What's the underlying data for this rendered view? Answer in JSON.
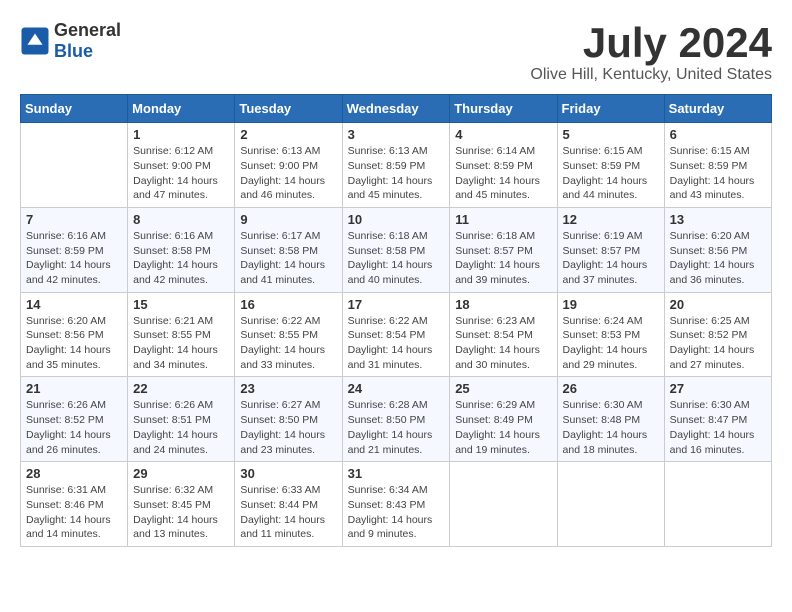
{
  "logo": {
    "text_general": "General",
    "text_blue": "Blue"
  },
  "title": "July 2024",
  "subtitle": "Olive Hill, Kentucky, United States",
  "weekdays": [
    "Sunday",
    "Monday",
    "Tuesday",
    "Wednesday",
    "Thursday",
    "Friday",
    "Saturday"
  ],
  "weeks": [
    [
      {
        "day": "",
        "info": ""
      },
      {
        "day": "1",
        "info": "Sunrise: 6:12 AM\nSunset: 9:00 PM\nDaylight: 14 hours\nand 47 minutes."
      },
      {
        "day": "2",
        "info": "Sunrise: 6:13 AM\nSunset: 9:00 PM\nDaylight: 14 hours\nand 46 minutes."
      },
      {
        "day": "3",
        "info": "Sunrise: 6:13 AM\nSunset: 8:59 PM\nDaylight: 14 hours\nand 45 minutes."
      },
      {
        "day": "4",
        "info": "Sunrise: 6:14 AM\nSunset: 8:59 PM\nDaylight: 14 hours\nand 45 minutes."
      },
      {
        "day": "5",
        "info": "Sunrise: 6:15 AM\nSunset: 8:59 PM\nDaylight: 14 hours\nand 44 minutes."
      },
      {
        "day": "6",
        "info": "Sunrise: 6:15 AM\nSunset: 8:59 PM\nDaylight: 14 hours\nand 43 minutes."
      }
    ],
    [
      {
        "day": "7",
        "info": "Sunrise: 6:16 AM\nSunset: 8:59 PM\nDaylight: 14 hours\nand 42 minutes."
      },
      {
        "day": "8",
        "info": "Sunrise: 6:16 AM\nSunset: 8:58 PM\nDaylight: 14 hours\nand 42 minutes."
      },
      {
        "day": "9",
        "info": "Sunrise: 6:17 AM\nSunset: 8:58 PM\nDaylight: 14 hours\nand 41 minutes."
      },
      {
        "day": "10",
        "info": "Sunrise: 6:18 AM\nSunset: 8:58 PM\nDaylight: 14 hours\nand 40 minutes."
      },
      {
        "day": "11",
        "info": "Sunrise: 6:18 AM\nSunset: 8:57 PM\nDaylight: 14 hours\nand 39 minutes."
      },
      {
        "day": "12",
        "info": "Sunrise: 6:19 AM\nSunset: 8:57 PM\nDaylight: 14 hours\nand 37 minutes."
      },
      {
        "day": "13",
        "info": "Sunrise: 6:20 AM\nSunset: 8:56 PM\nDaylight: 14 hours\nand 36 minutes."
      }
    ],
    [
      {
        "day": "14",
        "info": "Sunrise: 6:20 AM\nSunset: 8:56 PM\nDaylight: 14 hours\nand 35 minutes."
      },
      {
        "day": "15",
        "info": "Sunrise: 6:21 AM\nSunset: 8:55 PM\nDaylight: 14 hours\nand 34 minutes."
      },
      {
        "day": "16",
        "info": "Sunrise: 6:22 AM\nSunset: 8:55 PM\nDaylight: 14 hours\nand 33 minutes."
      },
      {
        "day": "17",
        "info": "Sunrise: 6:22 AM\nSunset: 8:54 PM\nDaylight: 14 hours\nand 31 minutes."
      },
      {
        "day": "18",
        "info": "Sunrise: 6:23 AM\nSunset: 8:54 PM\nDaylight: 14 hours\nand 30 minutes."
      },
      {
        "day": "19",
        "info": "Sunrise: 6:24 AM\nSunset: 8:53 PM\nDaylight: 14 hours\nand 29 minutes."
      },
      {
        "day": "20",
        "info": "Sunrise: 6:25 AM\nSunset: 8:52 PM\nDaylight: 14 hours\nand 27 minutes."
      }
    ],
    [
      {
        "day": "21",
        "info": "Sunrise: 6:26 AM\nSunset: 8:52 PM\nDaylight: 14 hours\nand 26 minutes."
      },
      {
        "day": "22",
        "info": "Sunrise: 6:26 AM\nSunset: 8:51 PM\nDaylight: 14 hours\nand 24 minutes."
      },
      {
        "day": "23",
        "info": "Sunrise: 6:27 AM\nSunset: 8:50 PM\nDaylight: 14 hours\nand 23 minutes."
      },
      {
        "day": "24",
        "info": "Sunrise: 6:28 AM\nSunset: 8:50 PM\nDaylight: 14 hours\nand 21 minutes."
      },
      {
        "day": "25",
        "info": "Sunrise: 6:29 AM\nSunset: 8:49 PM\nDaylight: 14 hours\nand 19 minutes."
      },
      {
        "day": "26",
        "info": "Sunrise: 6:30 AM\nSunset: 8:48 PM\nDaylight: 14 hours\nand 18 minutes."
      },
      {
        "day": "27",
        "info": "Sunrise: 6:30 AM\nSunset: 8:47 PM\nDaylight: 14 hours\nand 16 minutes."
      }
    ],
    [
      {
        "day": "28",
        "info": "Sunrise: 6:31 AM\nSunset: 8:46 PM\nDaylight: 14 hours\nand 14 minutes."
      },
      {
        "day": "29",
        "info": "Sunrise: 6:32 AM\nSunset: 8:45 PM\nDaylight: 14 hours\nand 13 minutes."
      },
      {
        "day": "30",
        "info": "Sunrise: 6:33 AM\nSunset: 8:44 PM\nDaylight: 14 hours\nand 11 minutes."
      },
      {
        "day": "31",
        "info": "Sunrise: 6:34 AM\nSunset: 8:43 PM\nDaylight: 14 hours\nand 9 minutes."
      },
      {
        "day": "",
        "info": ""
      },
      {
        "day": "",
        "info": ""
      },
      {
        "day": "",
        "info": ""
      }
    ]
  ]
}
